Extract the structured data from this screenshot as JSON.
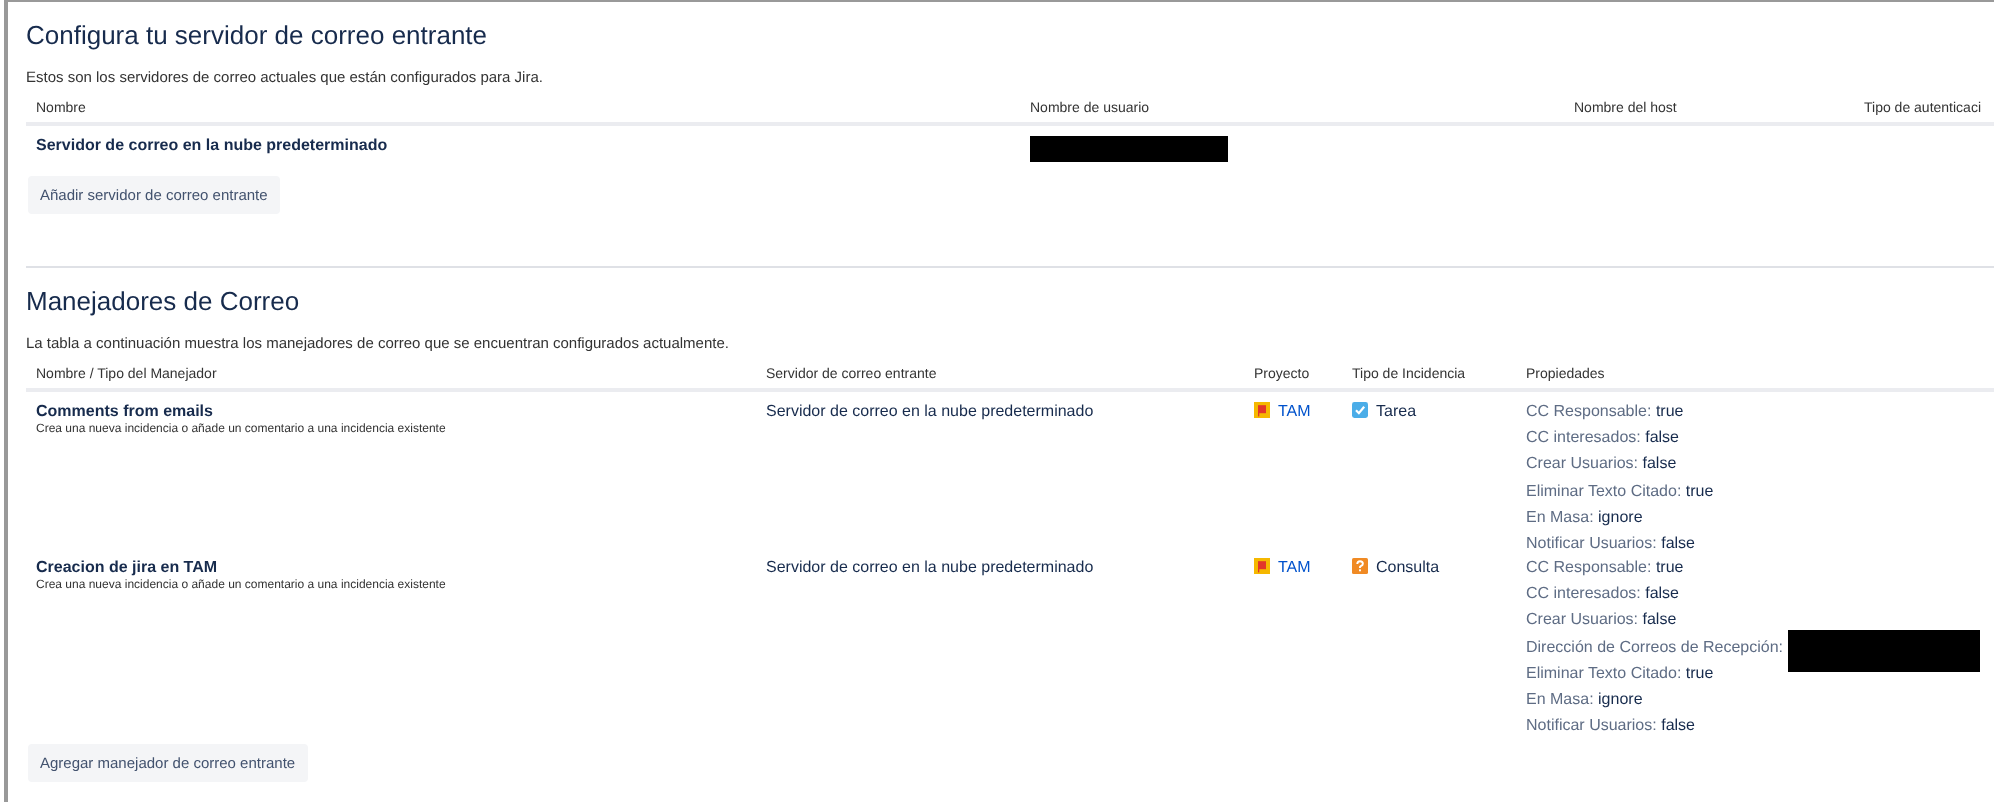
{
  "servers": {
    "title": "Configura tu servidor de correo entrante",
    "description": "Estos son los servidores de correo actuales que están configurados para Jira.",
    "columns": [
      "Nombre",
      "Nombre de usuario",
      "Nombre del host",
      "Tipo de autenticaci"
    ],
    "rows": [
      {
        "name": "Servidor de correo en la nube predeterminado",
        "username_redacted": true
      }
    ],
    "add_button": "Añadir servidor de correo entrante"
  },
  "handlers": {
    "title": "Manejadores de Correo",
    "description": "La tabla a continuación muestra los manejadores de correo que se encuentran configurados actualmente.",
    "columns": [
      "Nombre / Tipo del Manejador",
      "Servidor de correo entrante",
      "Proyecto",
      "Tipo de Incidencia",
      "Propiedades"
    ],
    "rows": [
      {
        "name": "Comments from emails",
        "type": "Crea una nueva incidencia o añade un comentario a una incidencia existente",
        "server": "Servidor de correo en la nube predeterminado",
        "project": "TAM",
        "issue_type": {
          "kind": "task",
          "label": "Tarea"
        },
        "properties": [
          {
            "label": "CC Responsable:",
            "value": "true"
          },
          {
            "label": "CC interesados:",
            "value": "false"
          },
          {
            "label": "Crear Usuarios:",
            "value": "false"
          },
          {
            "label": "Eliminar Texto Citado:",
            "value": "true"
          },
          {
            "label": "En Masa:",
            "value": "ignore"
          },
          {
            "label": "Notificar Usuarios:",
            "value": "false"
          }
        ]
      },
      {
        "name": "Creacion de jira en TAM",
        "type": "Crea una nueva incidencia o añade un comentario a una incidencia existente",
        "server": "Servidor de correo en la nube predeterminado",
        "project": "TAM",
        "issue_type": {
          "kind": "question",
          "label": "Consulta"
        },
        "properties": [
          {
            "label": "CC Responsable:",
            "value": "true"
          },
          {
            "label": "CC interesados:",
            "value": "false"
          },
          {
            "label": "Crear Usuarios:",
            "value": "false"
          },
          {
            "label": "Dirección de Correos de Recepción:",
            "redacted": true
          },
          {
            "label": "Eliminar Texto Citado:",
            "value": "true"
          },
          {
            "label": "En Masa:",
            "value": "ignore"
          },
          {
            "label": "Notificar Usuarios:",
            "value": "false"
          }
        ]
      }
    ],
    "add_button": "Agregar manejador de correo entrante"
  }
}
